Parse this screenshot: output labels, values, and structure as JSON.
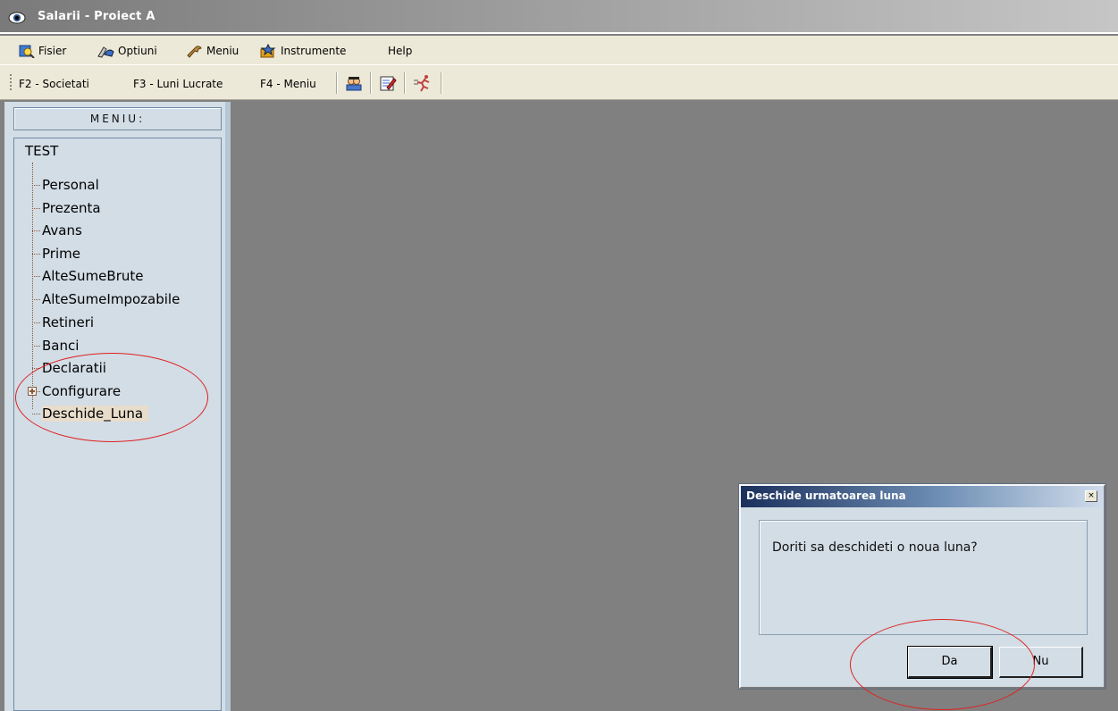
{
  "window": {
    "title": "Salarii - Proiect A",
    "icon": "eye-icon"
  },
  "menubar": {
    "items": [
      {
        "label": "Fisier",
        "icon": "search-document-icon"
      },
      {
        "label": "Optiuni",
        "icon": "tools-hand-icon"
      },
      {
        "label": "Meniu",
        "icon": "wrench-icon"
      },
      {
        "label": "Instrumente",
        "icon": "star-tools-icon"
      },
      {
        "label": "Help",
        "icon": ""
      }
    ]
  },
  "toolbar": {
    "buttons": [
      {
        "label": "F2 - Societati"
      },
      {
        "label": "F3 - Luni Lucrate"
      },
      {
        "label": "F4 - Meniu"
      }
    ],
    "icons": [
      "users-icon",
      "edit-form-icon",
      "exit-runner-icon"
    ]
  },
  "sidebar": {
    "header": "MENIU:",
    "root": "TEST",
    "items": [
      {
        "label": "Personal"
      },
      {
        "label": "Prezenta"
      },
      {
        "label": "Avans"
      },
      {
        "label": "Prime"
      },
      {
        "label": "AlteSumeBrute"
      },
      {
        "label": "AlteSumeImpozabile"
      },
      {
        "label": "Retineri"
      },
      {
        "label": "Banci"
      },
      {
        "label": "Declaratii"
      },
      {
        "label": "Configurare",
        "expandable": true
      },
      {
        "label": "Deschide_Luna",
        "selected": true
      }
    ]
  },
  "dialog": {
    "title": "Deschide urmatoarea luna",
    "close_label": "×",
    "message": "Doriti sa deschideti o noua luna?",
    "yes_label": "Da",
    "no_label": "Nu"
  },
  "colors": {
    "workspace": "#808080",
    "panel": "#d2dde6",
    "annotation": "#e02020",
    "dialog_title_start": "#1a2f5c"
  }
}
